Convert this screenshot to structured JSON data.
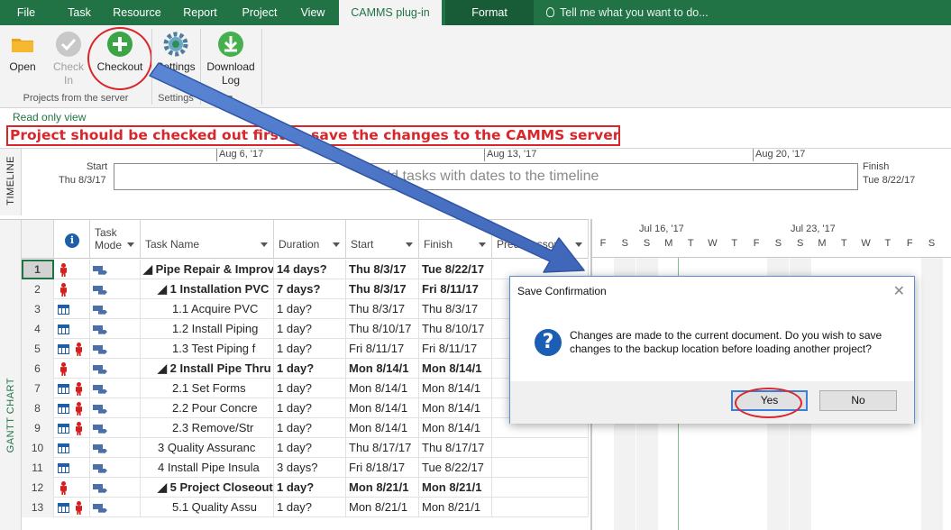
{
  "tabs": [
    {
      "label": "File"
    },
    {
      "label": "Task"
    },
    {
      "label": "Resource"
    },
    {
      "label": "Report"
    },
    {
      "label": "Project"
    },
    {
      "label": "View"
    },
    {
      "label": "CAMMS plug-in",
      "active": true
    },
    {
      "label": "Format"
    }
  ],
  "tell_me": "Tell me what you want to do...",
  "ribbon": {
    "open": "Open",
    "check_in_1": "Check",
    "check_in_2": "In",
    "checkout": "Checkout",
    "settings": "Settings",
    "download_1": "Download",
    "download_2": "Log",
    "group_projects": "Projects from the server",
    "group_settings": "Settings",
    "group_log_partial": "og"
  },
  "read_only": "Read only view",
  "warning": "Project should be checked out first to save the changes to the CAMMS server.",
  "timeline": {
    "label": "TIMELINE",
    "start_label": "Start",
    "start_date": "Thu 8/3/17",
    "finish_label": "Finish",
    "finish_date": "Tue 8/22/17",
    "placeholder": "Add tasks with dates to the timeline",
    "ticks": [
      "Aug 6, '17",
      "Aug 13, '17",
      "Aug 20, '17"
    ]
  },
  "gantt_label": "GANTT CHART",
  "columns": {
    "mode_1": "Task",
    "mode_2": "Mode",
    "name": "Task Name",
    "duration": "Duration",
    "start": "Start",
    "finish": "Finish",
    "predecessors": "Predecessors"
  },
  "rows": [
    {
      "id": "1",
      "ind": "person",
      "name": "◢ Pipe Repair & Improv",
      "indent": 0,
      "duration": "14 days?",
      "start": "Thu 8/3/17",
      "finish": "Tue 8/22/17",
      "bold": true
    },
    {
      "id": "2",
      "ind": "person",
      "name": "◢ 1 Installation PVC",
      "indent": 1,
      "duration": "7 days?",
      "start": "Thu 8/3/17",
      "finish": "Fri 8/11/17",
      "bold": true
    },
    {
      "id": "3",
      "ind": "cal",
      "name": "1.1 Acquire PVC",
      "indent": 2,
      "duration": "1 day?",
      "start": "Thu 8/3/17",
      "finish": "Thu 8/3/17",
      "bold": false
    },
    {
      "id": "4",
      "ind": "cal",
      "name": "1.2 Install Piping",
      "indent": 2,
      "duration": "1 day?",
      "start": "Thu 8/10/17",
      "finish": "Thu 8/10/17",
      "bold": false
    },
    {
      "id": "5",
      "ind": "calperson",
      "name": "1.3 Test Piping f",
      "indent": 2,
      "duration": "1 day?",
      "start": "Fri 8/11/17",
      "finish": "Fri 8/11/17",
      "bold": false
    },
    {
      "id": "6",
      "ind": "person",
      "name": "◢ 2 Install Pipe Thru",
      "indent": 1,
      "duration": "1 day?",
      "start": "Mon 8/14/1",
      "finish": "Mon 8/14/1",
      "bold": true
    },
    {
      "id": "7",
      "ind": "calperson",
      "name": "2.1 Set Forms",
      "indent": 2,
      "duration": "1 day?",
      "start": "Mon 8/14/1",
      "finish": "Mon 8/14/1",
      "bold": false
    },
    {
      "id": "8",
      "ind": "calperson",
      "name": "2.2 Pour Concre",
      "indent": 2,
      "duration": "1 day?",
      "start": "Mon 8/14/1",
      "finish": "Mon 8/14/1",
      "bold": false
    },
    {
      "id": "9",
      "ind": "calperson",
      "name": "2.3 Remove/Str",
      "indent": 2,
      "duration": "1 day?",
      "start": "Mon 8/14/1",
      "finish": "Mon 8/14/1",
      "bold": false
    },
    {
      "id": "10",
      "ind": "cal",
      "name": "3 Quality Assuranc",
      "indent": 1,
      "duration": "1 day?",
      "start": "Thu 8/17/17",
      "finish": "Thu 8/17/17",
      "bold": false
    },
    {
      "id": "11",
      "ind": "cal",
      "name": "4 Install Pipe Insula",
      "indent": 1,
      "duration": "3 days?",
      "start": "Fri 8/18/17",
      "finish": "Tue 8/22/17",
      "bold": false
    },
    {
      "id": "12",
      "ind": "person",
      "name": "◢ 5 Project Closeout",
      "indent": 1,
      "duration": "1 day?",
      "start": "Mon 8/21/1",
      "finish": "Mon 8/21/1",
      "bold": true
    },
    {
      "id": "13",
      "ind": "calperson",
      "name": "5.1 Quality Assu",
      "indent": 2,
      "duration": "1 day?",
      "start": "Mon 8/21/1",
      "finish": "Mon 8/21/1",
      "bold": false
    }
  ],
  "chart": {
    "weeks": [
      "Jul 16, '17",
      "Jul 23, '17"
    ],
    "days": [
      "F",
      "S",
      "S",
      "M",
      "T",
      "W",
      "T",
      "F",
      "S",
      "S",
      "M",
      "T",
      "W",
      "T",
      "F",
      "S"
    ]
  },
  "dialog": {
    "title": "Save Confirmation",
    "close": "✕",
    "message": "Changes are made to the current document. Do you wish to save changes to the backup location before loading another project?",
    "yes": "Yes",
    "no": "No"
  },
  "colors": {
    "brand": "#217346",
    "highlight": "#d8262b",
    "arrow": "#4a72c4"
  }
}
